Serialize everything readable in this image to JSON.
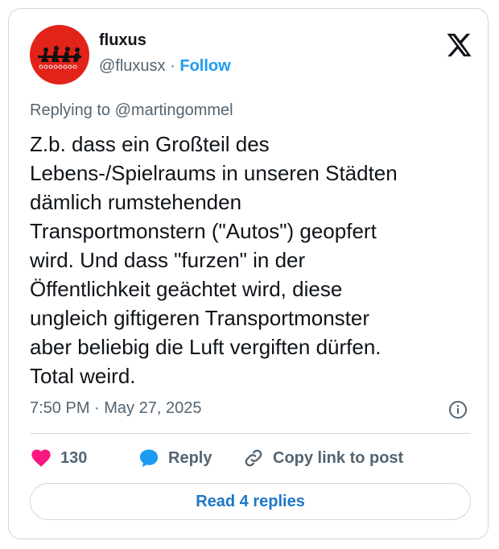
{
  "author": {
    "display_name": "fluxus",
    "handle": "@fluxusx",
    "separator": "·",
    "follow_label": "Follow",
    "avatar_color": "#e2231a"
  },
  "tweet": {
    "replying_to": "Replying to @martingommel",
    "text": "Z.b. dass ein Großteil des\nLebens-/Spielraums in unseren Städten\ndämlich rumstehenden\nTransportmonstern (\"Autos\") geopfert\nwird. Und dass \"furzen\" in der\nÖffentlichkeit geächtet wird, diese\nungleich giftigeren Transportmonster\naber beliebig die Luft vergiften dürfen.\nTotal weird.",
    "timestamp": "7:50 PM · May 27, 2025"
  },
  "actions": {
    "likes_count": "130",
    "reply_label": "Reply",
    "copy_link_label": "Copy link to post"
  },
  "read_replies_label": "Read 4 replies",
  "colors": {
    "accent": "#1d9bf0",
    "heart": "#f91880",
    "muted": "#536471",
    "border": "#cfd9de"
  },
  "icons": [
    "x-logo-icon",
    "info-icon",
    "heart-icon",
    "reply-bubble-icon",
    "link-icon"
  ]
}
